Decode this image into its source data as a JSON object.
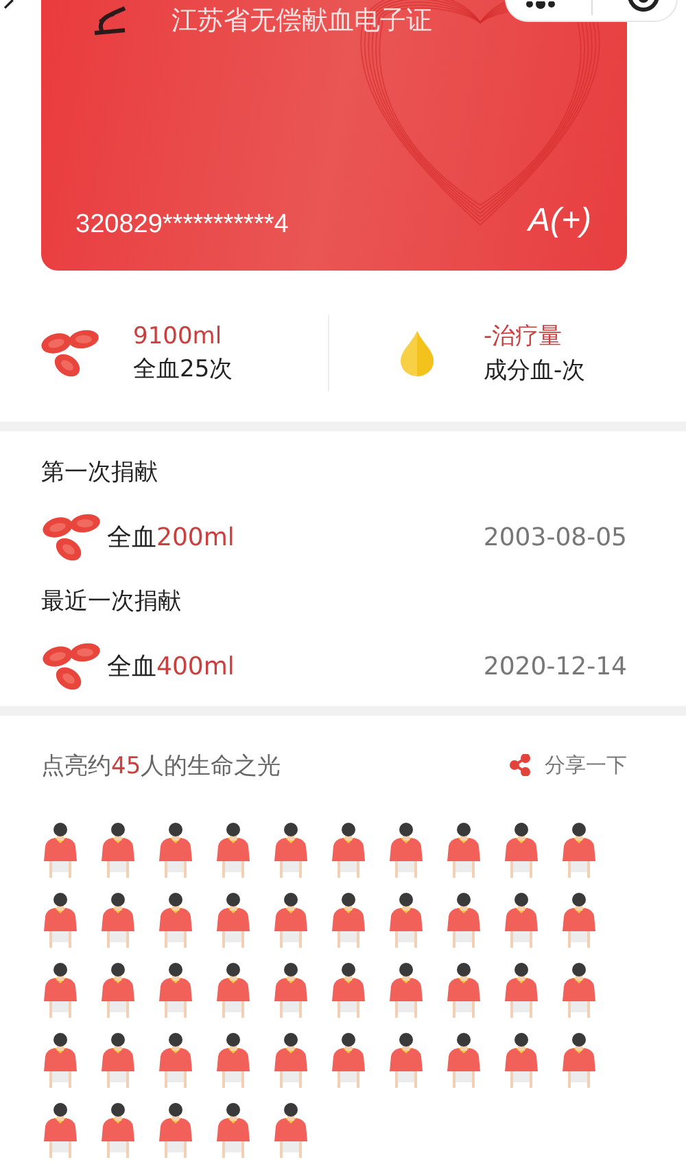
{
  "card": {
    "title": "江苏省无偿献血电子证",
    "id_number": "320829***********4",
    "blood_type": "A(+)"
  },
  "stats": [
    {
      "kind": "whole",
      "amount": "9100ml",
      "label": "全血25次"
    },
    {
      "kind": "component",
      "amount": "-治疗量",
      "label": "成分血-次"
    }
  ],
  "donations": [
    {
      "heading": "第一次捐献",
      "type": "全血",
      "amount": "200ml",
      "date": "2003-08-05"
    },
    {
      "heading": "最近一次捐献",
      "type": "全血",
      "amount": "400ml",
      "date": "2020-12-14"
    }
  ],
  "lives": {
    "headline": "点亮约**45**人的生命之光",
    "share": "分享一下"
  }
}
